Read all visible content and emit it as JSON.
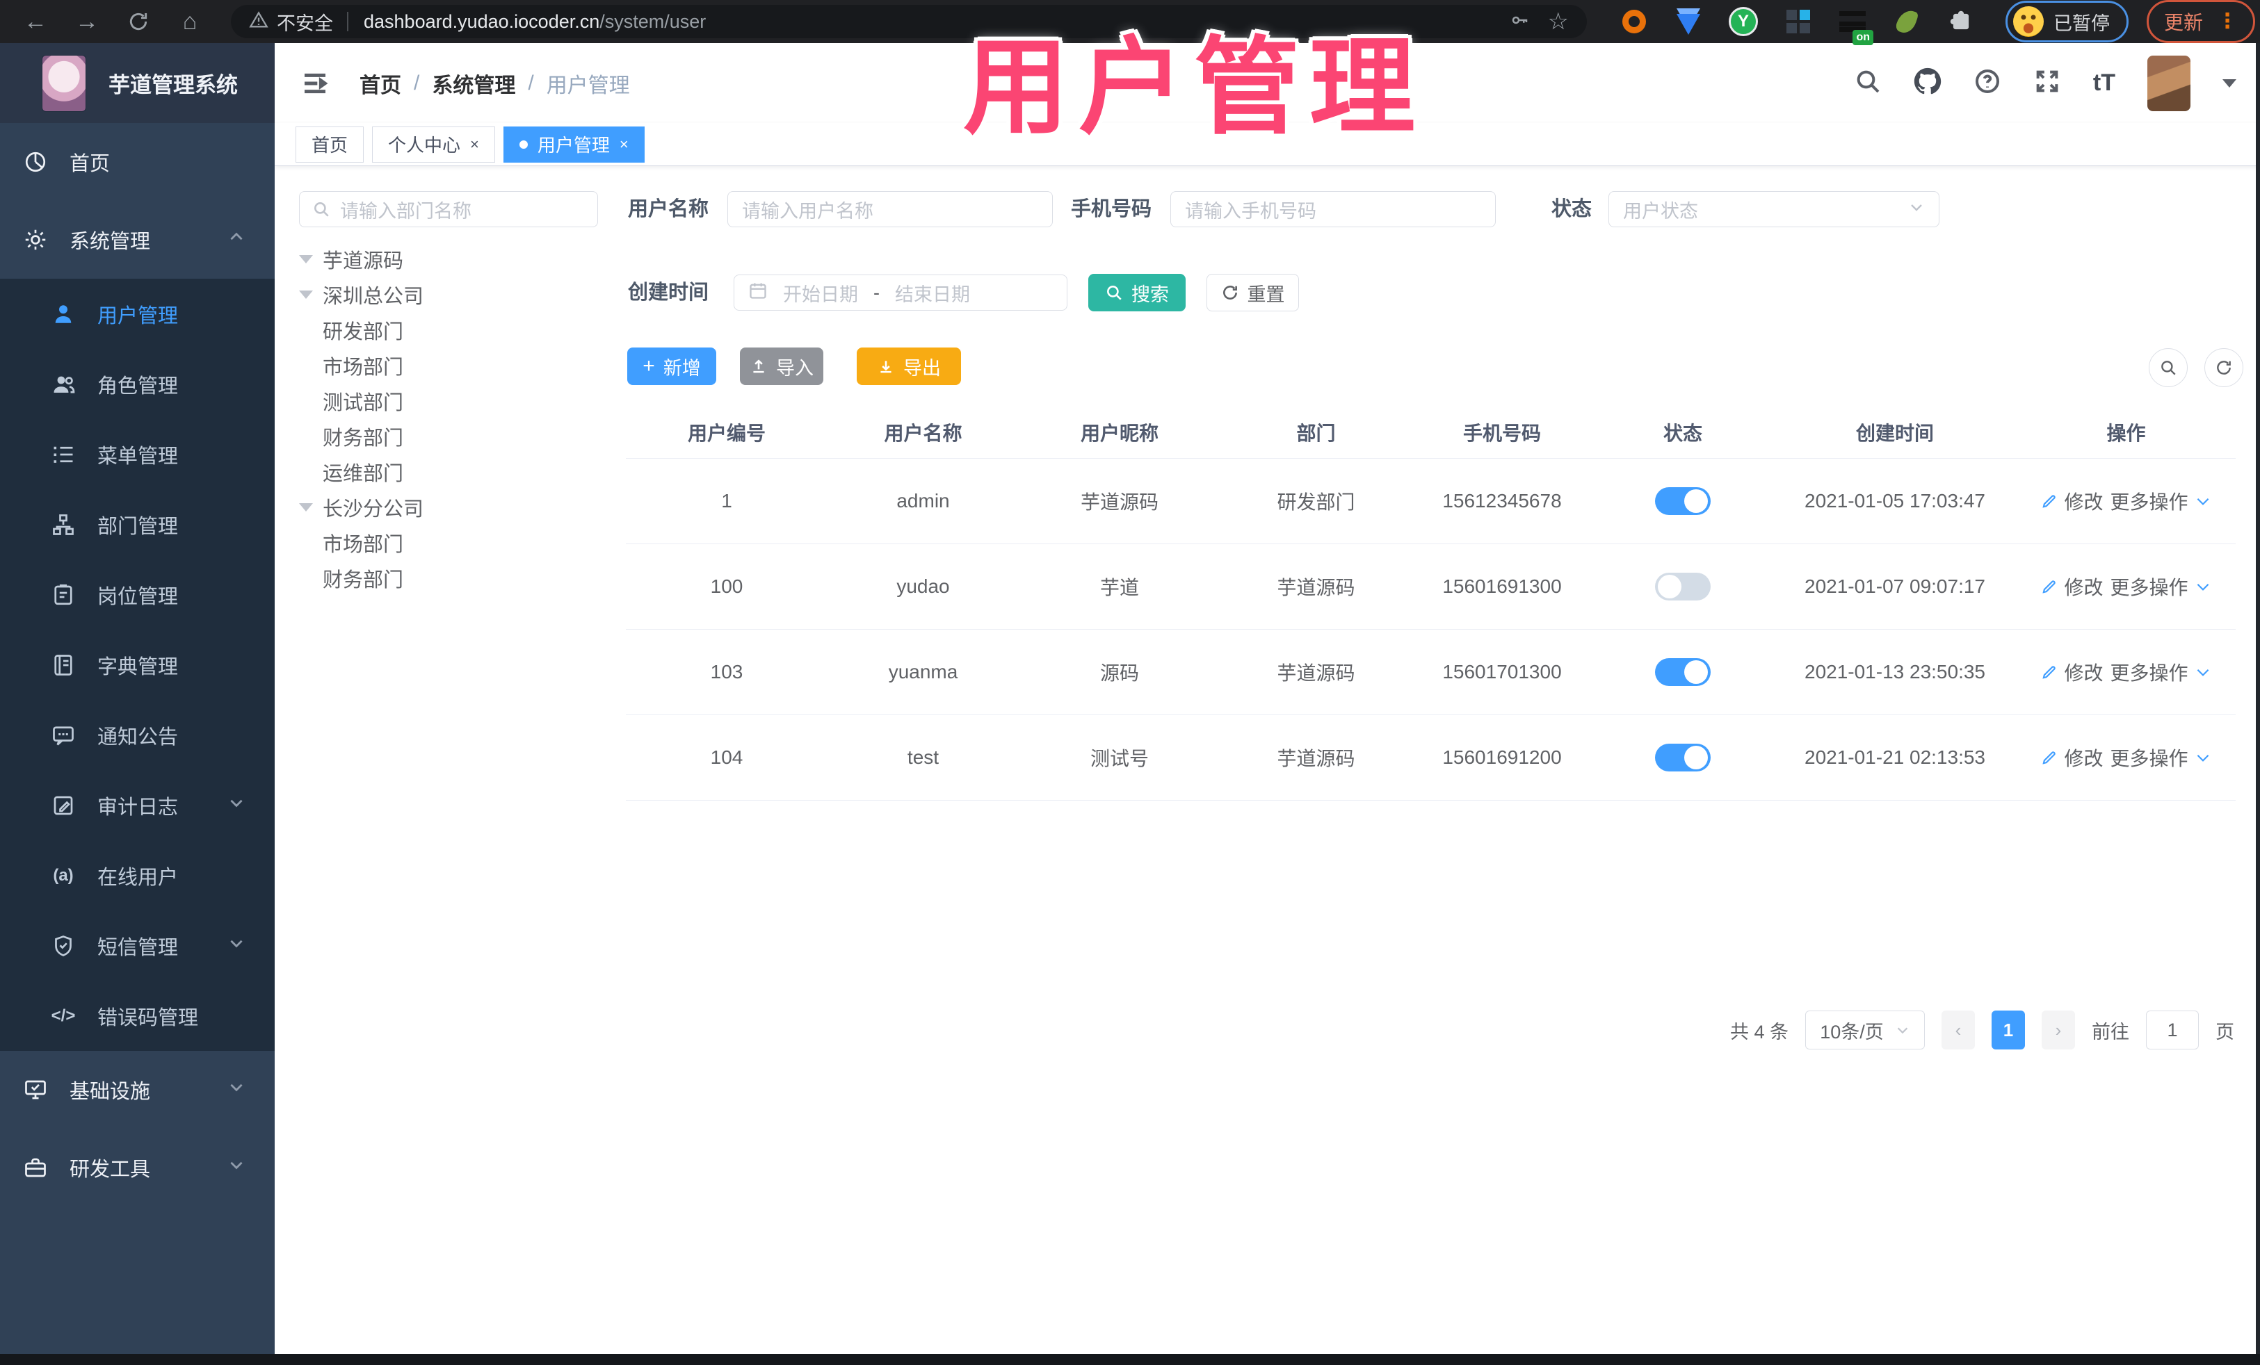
{
  "browser": {
    "security_label": "不安全",
    "url_host": "dashboard.yudao.iocoder.cn",
    "url_path": "/system/user",
    "profile_label": "已暂停",
    "update_label": "更新",
    "ext_green_letter": "Y",
    "ext_on_badge": "on"
  },
  "overlay": {
    "title": "用户管理",
    "color": "#fb4573"
  },
  "sidebar": {
    "logo_title": "芋道管理系统",
    "items": [
      {
        "label": "首页"
      },
      {
        "label": "系统管理"
      },
      {
        "label": "用户管理"
      },
      {
        "label": "角色管理"
      },
      {
        "label": "菜单管理"
      },
      {
        "label": "部门管理"
      },
      {
        "label": "岗位管理"
      },
      {
        "label": "字典管理"
      },
      {
        "label": "通知公告"
      },
      {
        "label": "审计日志"
      },
      {
        "label": "在线用户"
      },
      {
        "label": "短信管理"
      },
      {
        "label": "错误码管理"
      },
      {
        "label": "基础设施"
      },
      {
        "label": "研发工具"
      }
    ],
    "online_icon_text": "(a)",
    "code_icon_text": "</>"
  },
  "header": {
    "breadcrumb": [
      "首页",
      "系统管理",
      "用户管理"
    ],
    "fontsize_icon_text": "tT"
  },
  "tabs": [
    {
      "label": "首页"
    },
    {
      "label": "个人中心",
      "close": "×"
    },
    {
      "label": "用户管理",
      "close": "×"
    }
  ],
  "tree": {
    "search_placeholder": "请输入部门名称",
    "nodes": [
      {
        "label": "芋道源码",
        "indent": 0,
        "caret": true
      },
      {
        "label": "深圳总公司",
        "indent": 1,
        "caret": true
      },
      {
        "label": "研发部门",
        "indent": 2,
        "caret": false
      },
      {
        "label": "市场部门",
        "indent": 2,
        "caret": false
      },
      {
        "label": "测试部门",
        "indent": 2,
        "caret": false
      },
      {
        "label": "财务部门",
        "indent": 2,
        "caret": false
      },
      {
        "label": "运维部门",
        "indent": 2,
        "caret": false
      },
      {
        "label": "长沙分公司",
        "indent": 1,
        "caret": true
      },
      {
        "label": "市场部门",
        "indent": 2,
        "caret": false
      },
      {
        "label": "财务部门",
        "indent": 2,
        "caret": false
      }
    ]
  },
  "filters": {
    "username_label": "用户名称",
    "username_placeholder": "请输入用户名称",
    "mobile_label": "手机号码",
    "mobile_placeholder": "请输入手机号码",
    "status_label": "状态",
    "status_placeholder": "用户状态",
    "createtime_label": "创建时间",
    "date_start_placeholder": "开始日期",
    "date_separator": "-",
    "date_end_placeholder": "结束日期",
    "search_label": "搜索",
    "reset_label": "重置"
  },
  "toolbar": {
    "add_label": "新增",
    "import_label": "导入",
    "export_label": "导出"
  },
  "table": {
    "columns": [
      "用户编号",
      "用户名称",
      "用户昵称",
      "部门",
      "手机号码",
      "状态",
      "创建时间",
      "操作"
    ],
    "rows": [
      {
        "id": "1",
        "username": "admin",
        "nickname": "芋道源码",
        "dept": "研发部门",
        "mobile": "15612345678",
        "status": true,
        "create_time": "2021-01-05 17:03:47"
      },
      {
        "id": "100",
        "username": "yudao",
        "nickname": "芋道",
        "dept": "芋道源码",
        "mobile": "15601691300",
        "status": false,
        "create_time": "2021-01-07 09:07:17"
      },
      {
        "id": "103",
        "username": "yuanma",
        "nickname": "源码",
        "dept": "芋道源码",
        "mobile": "15601701300",
        "status": true,
        "create_time": "2021-01-13 23:50:35"
      },
      {
        "id": "104",
        "username": "test",
        "nickname": "测试号",
        "dept": "芋道源码",
        "mobile": "15601691200",
        "status": true,
        "create_time": "2021-01-21 02:13:53"
      }
    ]
  },
  "actions": {
    "edit_label": "修改",
    "more_label": "更多操作"
  },
  "pagination": {
    "total_label": "共 4 条",
    "page_size_label": "10条/页",
    "prev": "‹",
    "next": "›",
    "current_page": "1",
    "goto_label": "前往",
    "goto_value": "1",
    "page_unit_label": "页"
  },
  "colors": {
    "primary": "#409eff",
    "search_teal": "#2db7a3",
    "export_amber": "#f8ab13",
    "import_gray": "#909399",
    "sidebar_bg": "#304156",
    "submenu_bg": "#1f2d3d",
    "overlay_pink": "#fb4573",
    "active_tab": "#409eff"
  }
}
